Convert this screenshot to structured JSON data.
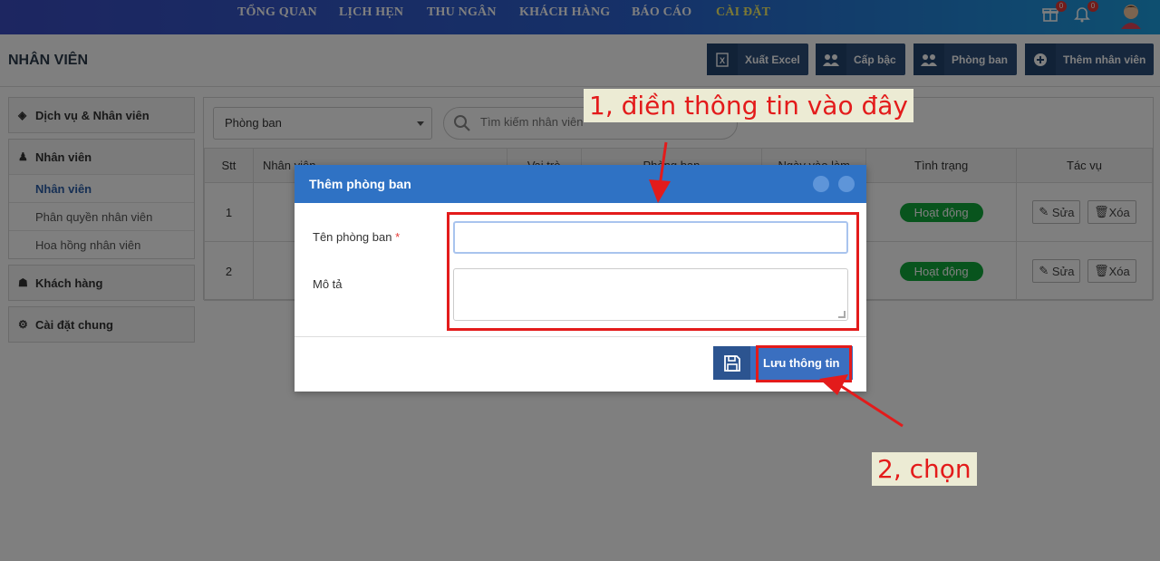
{
  "topnav": {
    "items": [
      "TỔNG QUAN",
      "LỊCH HẸN",
      "THU NGÂN",
      "KHÁCH HÀNG",
      "BÁO CÁO",
      "CÀI ĐẶT"
    ],
    "gift_badge": "0",
    "bell_badge": "0"
  },
  "header": {
    "title": "NHÂN VIÊN",
    "buttons": [
      "Xuất Excel",
      "Cấp bậc",
      "Phòng ban",
      "Thêm nhân viên"
    ]
  },
  "sidebar": {
    "services": "Dịch vụ & Nhân viên",
    "staff": "Nhân viên",
    "staff_items": [
      "Nhân viên",
      "Phân quyền nhân viên",
      "Hoa hồng nhân viên"
    ],
    "customers": "Khách hàng",
    "settings": "Cài đặt chung"
  },
  "main": {
    "filter_value": "Phòng ban",
    "search_placeholder": "Tìm kiếm nhân viên",
    "columns": [
      "Stt",
      "Nhân viên",
      "Vai trò",
      "Phòng ban",
      "Ngày vào làm",
      "Tình trạng",
      "Tác vụ"
    ],
    "rows": [
      {
        "stt": "1",
        "status": "Hoạt động",
        "edit": "Sửa",
        "delete": "Xóa"
      },
      {
        "stt": "2",
        "status": "Hoạt động",
        "edit": "Sửa",
        "delete": "Xóa"
      }
    ]
  },
  "modal": {
    "title": "Thêm phòng ban",
    "name_label": "Tên phòng ban",
    "required_mark": "*",
    "desc_label": "Mô tả",
    "name_value": "",
    "desc_value": "",
    "save_label": "Lưu thông tin"
  },
  "annotations": {
    "step1": "1, điền thông tin vào đây",
    "step2": "2, chọn"
  },
  "colors": {
    "annotation_red": "#e31b1b",
    "modal_header": "#2f72c4",
    "status_green": "#11a83a",
    "active_nav": "#f7f06a"
  }
}
